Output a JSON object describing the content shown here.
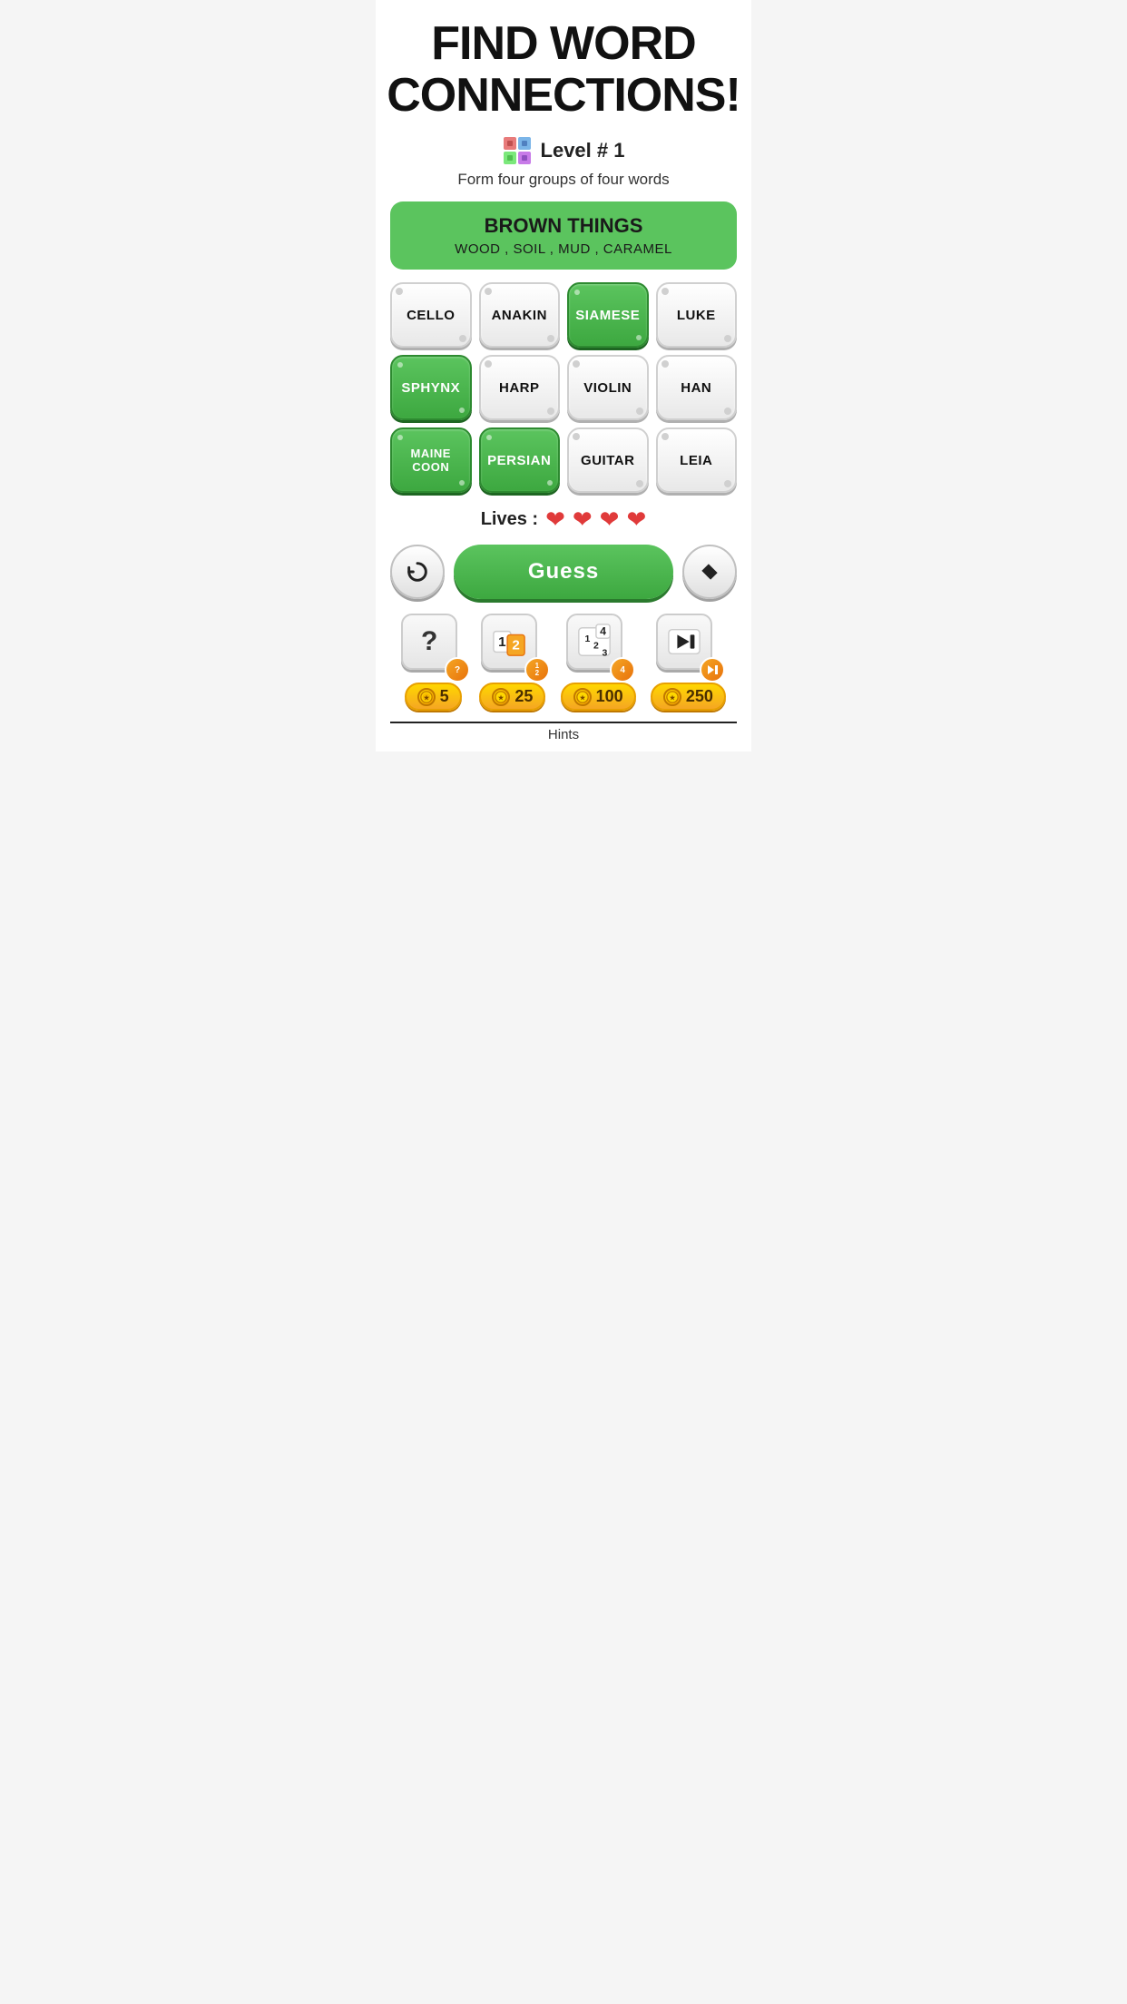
{
  "title": {
    "line1": "FIND WORD",
    "line2": "CONNECTIONS!"
  },
  "level": {
    "text": "Level # 1",
    "subtitle": "Form four groups of four words"
  },
  "solved_group": {
    "title": "BROWN THINGS",
    "words": "WOOD , SOIL , MUD , CARAMEL"
  },
  "tiles": [
    {
      "id": 0,
      "label": "CELLO",
      "selected": false
    },
    {
      "id": 1,
      "label": "ANAKIN",
      "selected": false
    },
    {
      "id": 2,
      "label": "SIAMESE",
      "selected": true
    },
    {
      "id": 3,
      "label": "LUKE",
      "selected": false
    },
    {
      "id": 4,
      "label": "SPHYNX",
      "selected": true
    },
    {
      "id": 5,
      "label": "HARP",
      "selected": false
    },
    {
      "id": 6,
      "label": "VIOLIN",
      "selected": false
    },
    {
      "id": 7,
      "label": "HAN",
      "selected": false
    },
    {
      "id": 8,
      "label": "MAINE\nCOON",
      "selected": true
    },
    {
      "id": 9,
      "label": "PERSIAN",
      "selected": true
    },
    {
      "id": 10,
      "label": "GUITAR",
      "selected": false
    },
    {
      "id": 11,
      "label": "LEIA",
      "selected": false
    }
  ],
  "lives": {
    "label": "Lives :",
    "count": 4,
    "heart": "❤"
  },
  "buttons": {
    "shuffle_label": "↺",
    "guess_label": "Guess",
    "erase_label": "◆"
  },
  "hints": [
    {
      "id": "hint-question",
      "symbol": "?",
      "cost": "5",
      "badge": "?"
    },
    {
      "id": "hint-swap",
      "symbol": "12",
      "cost": "25",
      "badge": "12"
    },
    {
      "id": "hint-reveal",
      "symbol": "123",
      "cost": "100",
      "badge": "4"
    },
    {
      "id": "hint-skip",
      "symbol": "▶|",
      "cost": "250",
      "badge": "▶|"
    }
  ],
  "hints_label": "Hints"
}
